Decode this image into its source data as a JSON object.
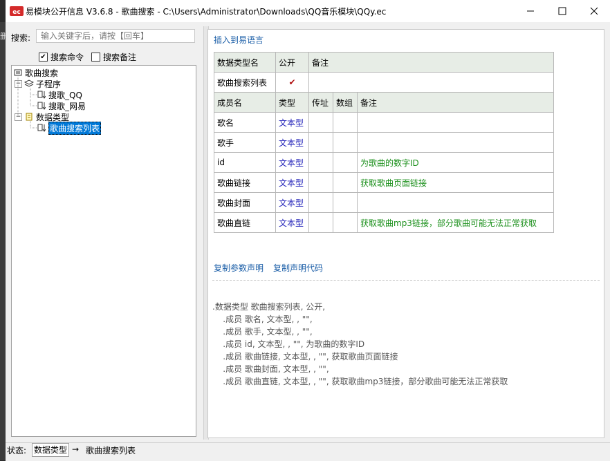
{
  "window": {
    "title": "易模块公开信息 V3.6.8 - 歌曲搜索 - C:\\Users\\Administrator\\Downloads\\QQ音乐模块\\QQy.ec",
    "minimize_icon": "minimize-icon",
    "maximize_icon": "maximize-icon",
    "close_icon": "close-icon"
  },
  "left": {
    "search_label": "搜索:",
    "search_placeholder": "输入关键字后，请按【回车】",
    "chk_cmd_label": "搜索命令",
    "chk_cmd_checked": true,
    "chk_note_label": "搜索备注",
    "chk_note_checked": false,
    "tree": {
      "root": "歌曲搜索",
      "sub": "子程序",
      "sub_items": [
        "搜歌_QQ",
        "搜歌_网易"
      ],
      "types": "数据类型",
      "type_items": [
        "歌曲搜索列表"
      ]
    }
  },
  "right": {
    "insert_link": "插入到易语言",
    "table": {
      "hdr1": [
        "数据类型名",
        "公开",
        "备注"
      ],
      "type_name": "歌曲搜索列表",
      "type_public": "✔",
      "hdr2": [
        "成员名",
        "类型",
        "传址",
        "数组",
        "备注"
      ],
      "members": [
        {
          "name": "歌名",
          "type": "文本型",
          "note": ""
        },
        {
          "name": "歌手",
          "type": "文本型",
          "note": ""
        },
        {
          "name": "id",
          "type": "文本型",
          "note": "为歌曲的数字ID"
        },
        {
          "name": "歌曲链接",
          "type": "文本型",
          "note": "获取歌曲页面链接"
        },
        {
          "name": "歌曲封面",
          "type": "文本型",
          "note": ""
        },
        {
          "name": "歌曲直链",
          "type": "文本型",
          "note": "获取歌曲mp3链接，部分歌曲可能无法正常获取"
        }
      ]
    },
    "copy_param_link": "复制参数声明",
    "copy_decl_link": "复制声明代码",
    "code_lines": [
      ".数据类型 歌曲搜索列表, 公开,",
      "    .成员 歌名, 文本型, , \"\",",
      "    .成员 歌手, 文本型, , \"\",",
      "    .成员 id, 文本型, , \"\", 为歌曲的数字ID",
      "    .成员 歌曲链接, 文本型, , \"\", 获取歌曲页面链接",
      "    .成员 歌曲封面, 文本型, , \"\",",
      "    .成员 歌曲直链, 文本型, , \"\", 获取歌曲mp3链接，部分歌曲可能无法正常获取"
    ]
  },
  "status": {
    "label": "状态:",
    "value": "数据类型",
    "arrow": "→",
    "target": "歌曲搜索列表"
  },
  "edge_glyph": "删"
}
